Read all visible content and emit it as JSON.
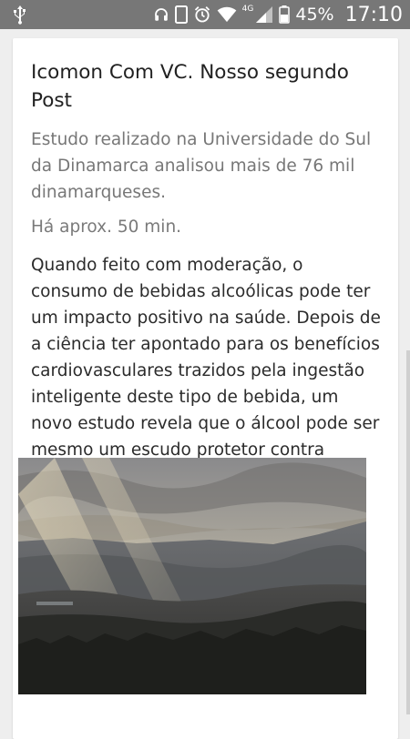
{
  "status_bar": {
    "network_label": "4G",
    "battery_percent": "45%",
    "time": "17:10",
    "icons": [
      "usb-icon",
      "headset-icon",
      "phone-icon",
      "alarm-icon",
      "wifi-icon",
      "signal-icon",
      "battery-icon"
    ]
  },
  "post": {
    "title": "Icomon Com VC. Nosso segundo Post",
    "subtitle": "Estudo realizado na Universidade do Sul da Dinamarca analisou mais de 76 mil dinamarqueses.",
    "time_ago": "Há aprox. 50 min.",
    "body": "Quando feito com moderação, o consumo de bebidas alcoólicas pode ter um impacto positivo na saúde. Depois de a ciência ter apontado para os benefícios cardiovasculares trazidos pela ingestão inteligente deste tipo de bebida, um novo estudo revela que o álcool pode ser mesmo um escudo protetor contra",
    "image": "landscape-photo"
  },
  "colors": {
    "status_bar": "#777777",
    "background": "#eeeeee",
    "card": "#ffffff",
    "title": "#212121",
    "subtitle": "#777777"
  }
}
